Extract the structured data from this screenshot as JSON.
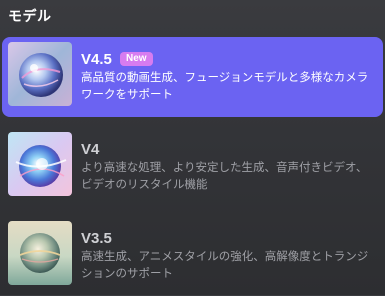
{
  "section": {
    "title": "モデル"
  },
  "models": [
    {
      "name": "V4.5",
      "badge": "New",
      "description": "高品質の動画生成、フュージョンモデルと多様なカメラワークをサポート",
      "selected": true
    },
    {
      "name": "V4",
      "description": "より高速な処理、より安定した生成、音声付きビデオ、ビデオのリスタイル機能",
      "selected": false
    },
    {
      "name": "V3.5",
      "description": "高速生成、アニメスタイルの強化、高解像度とトランジションのサポート",
      "selected": false
    }
  ],
  "colors": {
    "selected_bg": "#6b63f2",
    "badge_bg": "#d77cf0",
    "desc_gray": "#9fa0a6"
  }
}
